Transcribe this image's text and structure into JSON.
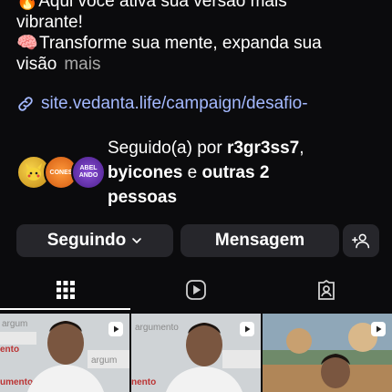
{
  "bio": {
    "line1_emoji": "🔥",
    "line1": "Aqui você ativa sua versão mais",
    "line2": "vibrante!",
    "line3_emoji": "🧠",
    "line3": "Transforme sua mente, expanda sua",
    "line4": "visão",
    "more": "mais"
  },
  "link": {
    "text": "site.vedanta.life/campaign/desafio-",
    "icon": "link-icon"
  },
  "followed_by": {
    "prefix": "Seguido(a) por ",
    "user1": "r3gr3ss7",
    "comma": ",",
    "user2": "byicones",
    "middle": " e ",
    "others": "outras 2",
    "last": "pessoas",
    "avatar_labels": [
      "",
      "CONES",
      "ABEL ANDO"
    ]
  },
  "actions": {
    "following_label": "Seguindo",
    "message_label": "Mensagem",
    "add_person_icon": "add-person-icon"
  },
  "tabs": [
    {
      "name": "grid",
      "icon": "grid-icon"
    },
    {
      "name": "reels",
      "icon": "reels-icon"
    },
    {
      "name": "tagged",
      "icon": "tagged-person-icon"
    }
  ],
  "posts": [
    {
      "caption": "argumento",
      "type": "reel"
    },
    {
      "caption": "argumento",
      "type": "reel"
    },
    {
      "caption": "",
      "type": "reel"
    }
  ],
  "colors": {
    "background": "#0b0b0d",
    "link": "#a4b9ff",
    "button": "#26262b",
    "muted": "#a8a8a8"
  }
}
